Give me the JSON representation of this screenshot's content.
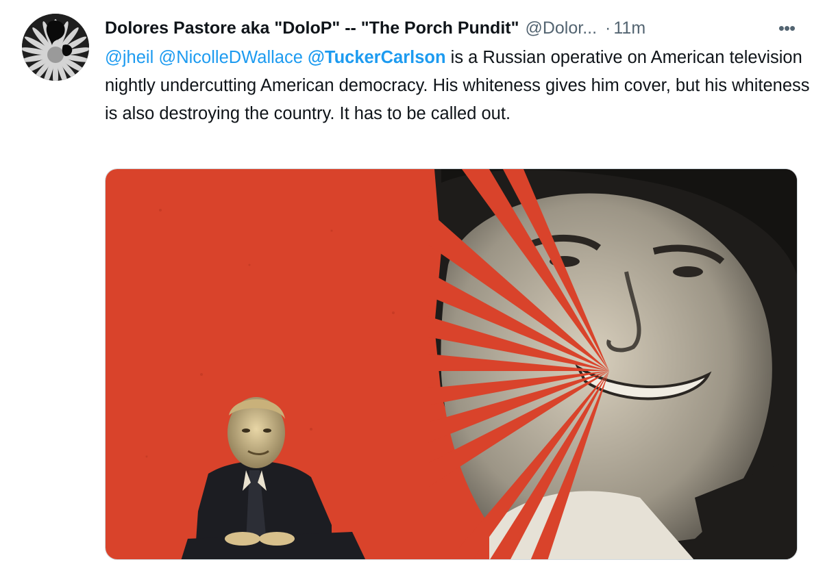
{
  "tweet": {
    "display_name": "Dolores Pastore aka \"DoloP\" -- \"The Porch Pundit\"",
    "handle": "@Dolor...",
    "separator": "·",
    "time": "11m",
    "more_label": "•••",
    "mentions": [
      "@jheil",
      "@NicolleDWallace",
      "@TuckerCarlson"
    ],
    "text_line1": " is a Russian operative on",
    "text_rest": "American television nightly undercutting American democracy. His whiteness gives him cover, but his whiteness is also destroying the country. It has to be called out."
  },
  "colors": {
    "link": "#1d9bf0",
    "text": "#0f1419",
    "secondary": "#536471",
    "poster_red": "#d9432b",
    "poster_tan": "#d9c7a0"
  },
  "icons": {
    "avatar": "flower-avatar",
    "more": "more-horizontal-icon"
  }
}
